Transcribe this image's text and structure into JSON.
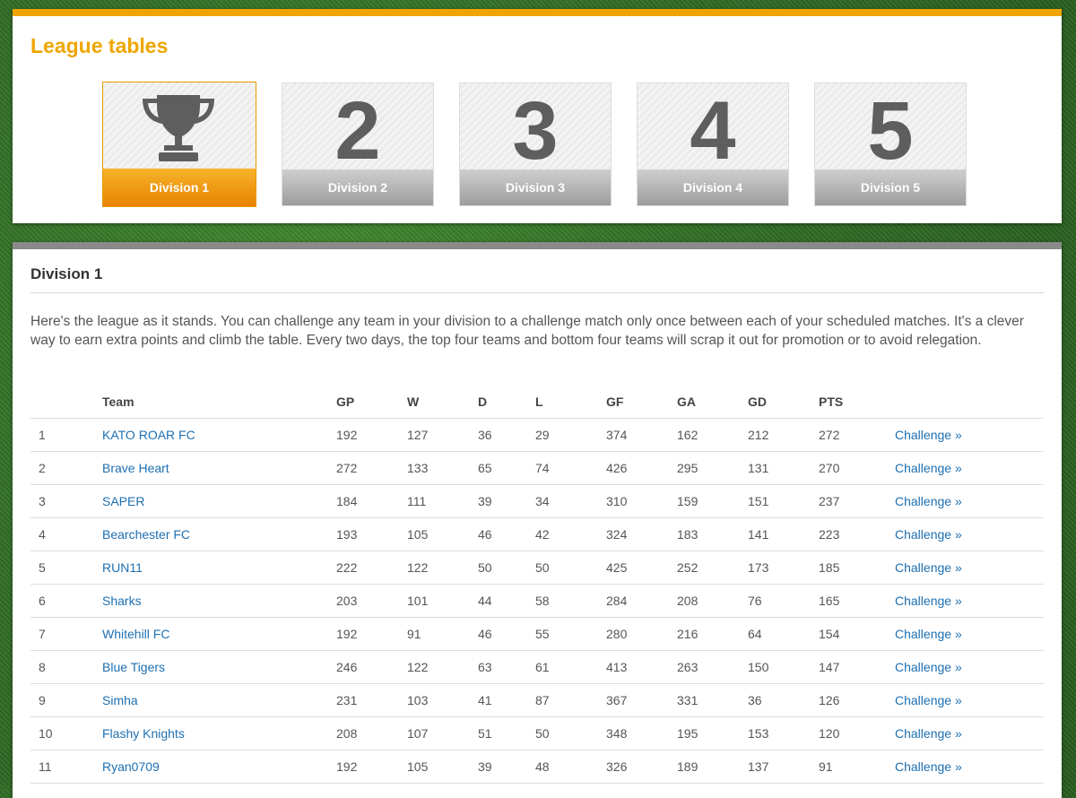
{
  "header": {
    "title": "League tables"
  },
  "divisions": [
    {
      "number": "",
      "label": "Division 1",
      "active": true,
      "icon": "trophy-icon"
    },
    {
      "number": "2",
      "label": "Division 2",
      "active": false
    },
    {
      "number": "3",
      "label": "Division 3",
      "active": false
    },
    {
      "number": "4",
      "label": "Division 4",
      "active": false
    },
    {
      "number": "5",
      "label": "Division 5",
      "active": false
    }
  ],
  "section": {
    "title": "Division 1",
    "intro": "Here's the league as it stands. You can challenge any team in your division to a challenge match only once between each of your scheduled matches. It's a clever way to earn extra points and climb the table. Every two days, the top four teams and bottom four teams will scrap it out for promotion or to avoid relegation."
  },
  "table": {
    "headers": [
      "",
      "Team",
      "GP",
      "W",
      "D",
      "L",
      "GF",
      "GA",
      "GD",
      "PTS",
      ""
    ],
    "rows": [
      {
        "pos": "1",
        "team": "KATO ROAR FC",
        "gp": "192",
        "w": "127",
        "d": "36",
        "l": "29",
        "gf": "374",
        "ga": "162",
        "gd": "212",
        "pts": "272",
        "action": "Challenge »"
      },
      {
        "pos": "2",
        "team": "Brave Heart",
        "gp": "272",
        "w": "133",
        "d": "65",
        "l": "74",
        "gf": "426",
        "ga": "295",
        "gd": "131",
        "pts": "270",
        "action": "Challenge »"
      },
      {
        "pos": "3",
        "team": "SAPER",
        "gp": "184",
        "w": "111",
        "d": "39",
        "l": "34",
        "gf": "310",
        "ga": "159",
        "gd": "151",
        "pts": "237",
        "action": "Challenge »"
      },
      {
        "pos": "4",
        "team": "Bearchester FC",
        "gp": "193",
        "w": "105",
        "d": "46",
        "l": "42",
        "gf": "324",
        "ga": "183",
        "gd": "141",
        "pts": "223",
        "action": "Challenge »"
      },
      {
        "pos": "5",
        "team": "RUN11",
        "gp": "222",
        "w": "122",
        "d": "50",
        "l": "50",
        "gf": "425",
        "ga": "252",
        "gd": "173",
        "pts": "185",
        "action": "Challenge »"
      },
      {
        "pos": "6",
        "team": "Sharks",
        "gp": "203",
        "w": "101",
        "d": "44",
        "l": "58",
        "gf": "284",
        "ga": "208",
        "gd": "76",
        "pts": "165",
        "action": "Challenge »"
      },
      {
        "pos": "7",
        "team": "Whitehill FC",
        "gp": "192",
        "w": "91",
        "d": "46",
        "l": "55",
        "gf": "280",
        "ga": "216",
        "gd": "64",
        "pts": "154",
        "action": "Challenge »"
      },
      {
        "pos": "8",
        "team": "Blue Tigers",
        "gp": "246",
        "w": "122",
        "d": "63",
        "l": "61",
        "gf": "413",
        "ga": "263",
        "gd": "150",
        "pts": "147",
        "action": "Challenge »"
      },
      {
        "pos": "9",
        "team": "Simha",
        "gp": "231",
        "w": "103",
        "d": "41",
        "l": "87",
        "gf": "367",
        "ga": "331",
        "gd": "36",
        "pts": "126",
        "action": "Challenge »"
      },
      {
        "pos": "10",
        "team": "Flashy Knights",
        "gp": "208",
        "w": "107",
        "d": "51",
        "l": "50",
        "gf": "348",
        "ga": "195",
        "gd": "153",
        "pts": "120",
        "action": "Challenge »"
      },
      {
        "pos": "11",
        "team": "Ryan0709",
        "gp": "192",
        "w": "105",
        "d": "39",
        "l": "48",
        "gf": "326",
        "ga": "189",
        "gd": "137",
        "pts": "91",
        "action": "Challenge »"
      }
    ]
  },
  "colors": {
    "accent": "#eea600",
    "link": "#1d6fb1",
    "inactive_tab": "#9d9d9d"
  }
}
